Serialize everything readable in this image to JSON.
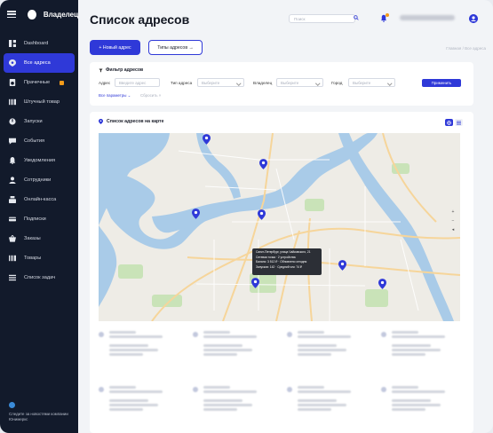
{
  "sidebar": {
    "brand": "Владелец",
    "items": [
      {
        "label": "Dashboard",
        "icon": "dashboard-icon",
        "active": false
      },
      {
        "label": "Все адреса",
        "icon": "location-pin-icon",
        "active": true
      },
      {
        "label": "Прачечные",
        "icon": "washing-machine-icon",
        "active": false,
        "badge": true
      },
      {
        "label": "Штучный товар",
        "icon": "barcode-icon",
        "active": false
      },
      {
        "label": "Запуски",
        "icon": "power-icon",
        "active": false
      },
      {
        "label": "События",
        "icon": "chat-icon",
        "active": false
      },
      {
        "label": "Уведомления",
        "icon": "bell-icon",
        "active": false
      },
      {
        "label": "Сотрудники",
        "icon": "user-icon",
        "active": false
      },
      {
        "label": "Онлайн-касса",
        "icon": "cash-register-icon",
        "active": false
      },
      {
        "label": "Подписки",
        "icon": "subscription-icon",
        "active": false
      },
      {
        "label": "Заказы",
        "icon": "basket-icon",
        "active": false
      },
      {
        "label": "Товары",
        "icon": "barcode-icon",
        "active": false
      },
      {
        "label": "Список задач",
        "icon": "task-list-icon",
        "active": false
      }
    ],
    "footer_text": "Следите за новостями компании Юнимеркс"
  },
  "header": {
    "title": "Список адресов",
    "search_placeholder": "Поиск"
  },
  "actions": {
    "new_address": "+ Новый адрес",
    "address_types": "Типы адресов →",
    "breadcrumb": "Главная / Все адреса"
  },
  "filter": {
    "title": "Фильтр адресов",
    "address_label": "Адрес",
    "address_placeholder": "Введите адрес",
    "type_label": "Тип адреса",
    "type_placeholder": "Выберите",
    "owner_label": "Владелец",
    "owner_placeholder": "Выберите",
    "city_label": "Город",
    "city_placeholder": "Выберите",
    "apply": "Применить",
    "more": "Все параметры",
    "reset": "Сбросить ×"
  },
  "map": {
    "title": "Список адресов на карте",
    "tooltip": {
      "line1": "Санкт-Петербург, улица Чайковского, 21",
      "line2": "Сетевая точка · 2 устройства",
      "line3": "Баланс: 3 512 ₽ · Обновлено сегодня",
      "line4": "Запусков: 142 · Средний чек: 74 ₽"
    }
  },
  "colors": {
    "accent": "#2f39d8",
    "sidebar_bg": "#121a2b",
    "badge": "#f39b1a"
  }
}
